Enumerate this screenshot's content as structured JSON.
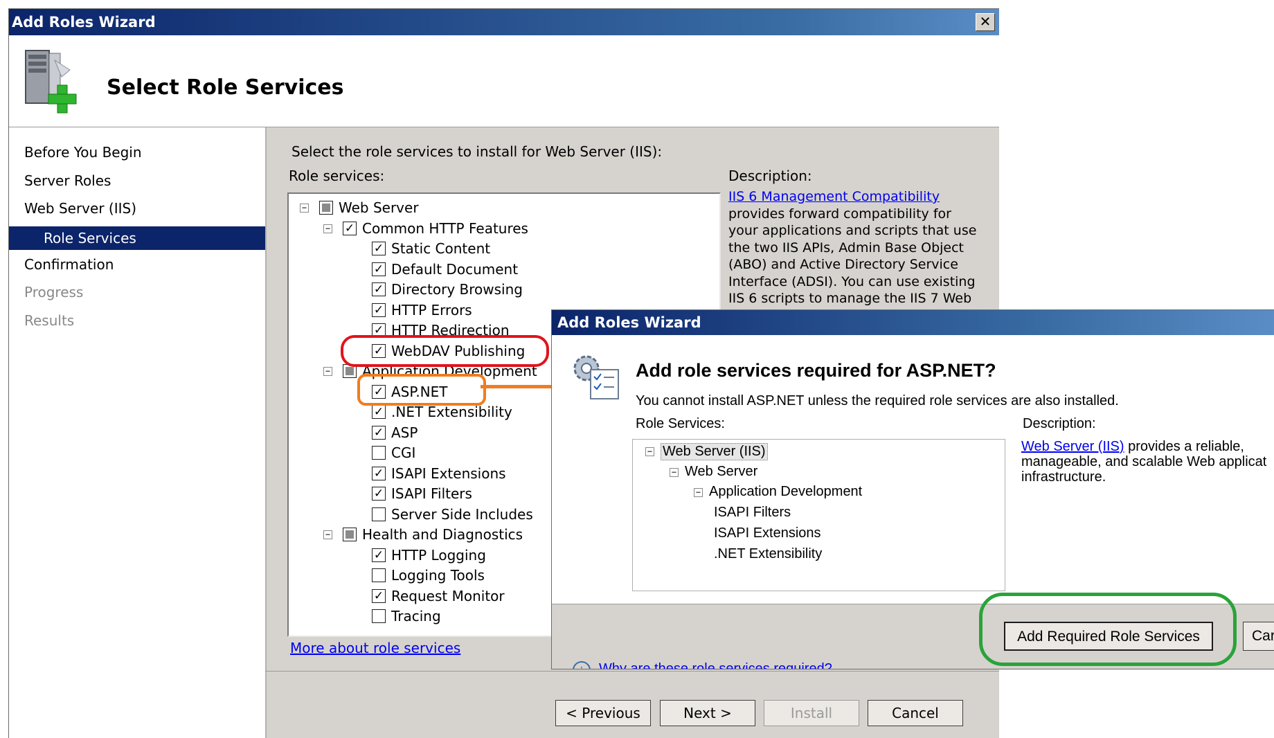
{
  "main_window": {
    "title": "Add Roles Wizard",
    "close_label": "✕",
    "header_title": "Select Role Services",
    "nav": [
      "Before You Begin",
      "Server Roles",
      "Web Server (IIS)",
      "Role Services",
      "Confirmation",
      "Progress",
      "Results"
    ],
    "instruction": "Select the role services to install for Web Server (IIS):",
    "role_services_label": "Role services:",
    "description_label": "Description:",
    "description_link": "IIS 6 Management Compatibility",
    "description_lines": [
      "provides forward compatibility for",
      "your applications and scripts that use",
      "the two IIS APIs, Admin Base Object",
      "(ABO) and Active Directory Service",
      "Interface (ADSI). You can use existing",
      "IIS 6 scripts to manage the IIS 7 Web"
    ],
    "tree": [
      {
        "label": "Web Server",
        "level": 0,
        "state": "partial",
        "expander": true
      },
      {
        "label": "Common HTTP Features",
        "level": 1,
        "state": "checked",
        "expander": true
      },
      {
        "label": "Static Content",
        "level": 2,
        "state": "checked"
      },
      {
        "label": "Default Document",
        "level": 2,
        "state": "checked"
      },
      {
        "label": "Directory Browsing",
        "level": 2,
        "state": "checked"
      },
      {
        "label": "HTTP Errors",
        "level": 2,
        "state": "checked"
      },
      {
        "label": "HTTP Redirection",
        "level": 2,
        "state": "checked"
      },
      {
        "label": "WebDAV Publishing",
        "level": 2,
        "state": "checked"
      },
      {
        "label": "Application Development",
        "level": 1,
        "state": "partial",
        "expander": true
      },
      {
        "label": "ASP.NET",
        "level": 2,
        "state": "checked"
      },
      {
        "label": ".NET Extensibility",
        "level": 2,
        "state": "checked"
      },
      {
        "label": "ASP",
        "level": 2,
        "state": "checked"
      },
      {
        "label": "CGI",
        "level": 2,
        "state": "unchecked"
      },
      {
        "label": "ISAPI Extensions",
        "level": 2,
        "state": "checked"
      },
      {
        "label": "ISAPI Filters",
        "level": 2,
        "state": "checked"
      },
      {
        "label": "Server Side Includes",
        "level": 2,
        "state": "unchecked"
      },
      {
        "label": "Health and Diagnostics",
        "level": 1,
        "state": "partial",
        "expander": true
      },
      {
        "label": "HTTP Logging",
        "level": 2,
        "state": "checked"
      },
      {
        "label": "Logging Tools",
        "level": 2,
        "state": "unchecked"
      },
      {
        "label": "Request Monitor",
        "level": 2,
        "state": "checked"
      },
      {
        "label": "Tracing",
        "level": 2,
        "state": "unchecked"
      }
    ],
    "more_link": "More about role services",
    "buttons": {
      "previous": "< Previous",
      "next": "Next >",
      "install": "Install",
      "cancel": "Cancel"
    }
  },
  "dialog": {
    "title": "Add Roles Wizard",
    "heading": "Add role services required for ASP.NET?",
    "message": "You cannot install ASP.NET unless the required role services are also installed.",
    "role_services_label": "Role Services:",
    "description_label": "Description:",
    "description_link": "Web Server (IIS)",
    "description_rest": " provides a reliable,",
    "description_lines": [
      "manageable, and scalable Web applicat",
      "infrastructure."
    ],
    "tree": [
      {
        "label": "Web Server (IIS)",
        "level": 0,
        "expander": true,
        "selected": true
      },
      {
        "label": "Web Server",
        "level": 1,
        "expander": true
      },
      {
        "label": "Application Development",
        "level": 2,
        "expander": true
      },
      {
        "label": "ISAPI Filters",
        "level": 3
      },
      {
        "label": "ISAPI Extensions",
        "level": 3
      },
      {
        "label": ".NET Extensibility",
        "level": 3
      }
    ],
    "add_button": "Add Required Role Services",
    "cancel_button": "Car",
    "help_text": "Why are these role services required?"
  },
  "highlight_colors": {
    "webdav": "#e0141b",
    "aspnet": "#f07c1f",
    "add_button": "#2aa33a"
  }
}
